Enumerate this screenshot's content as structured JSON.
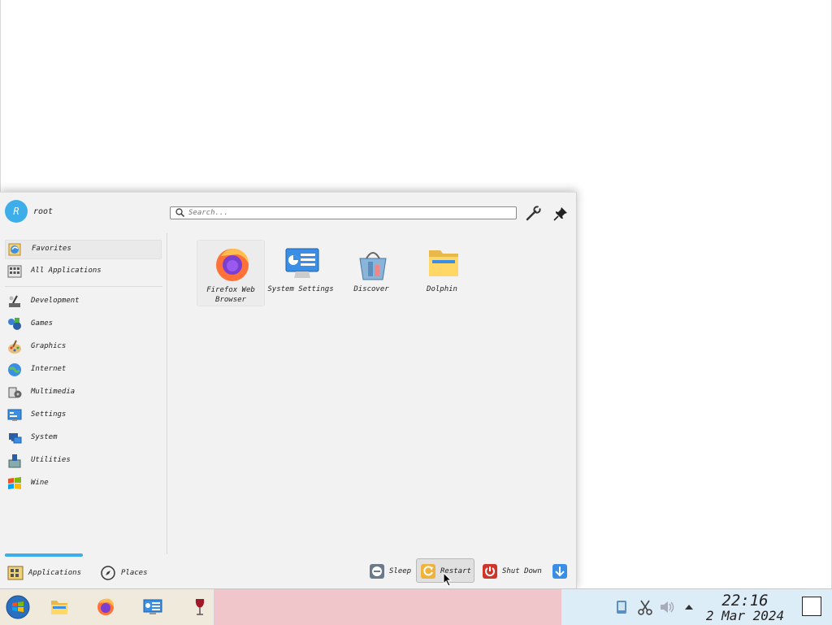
{
  "user": {
    "initial": "R",
    "name": "root"
  },
  "search": {
    "placeholder": "Search..."
  },
  "sidebar": {
    "items": [
      {
        "label": "Favorites",
        "icon": "favorites-icon",
        "active": true
      },
      {
        "label": "All Applications",
        "icon": "all-applications-icon"
      },
      {
        "label": "Development",
        "icon": "development-icon"
      },
      {
        "label": "Games",
        "icon": "games-icon"
      },
      {
        "label": "Graphics",
        "icon": "graphics-icon"
      },
      {
        "label": "Internet",
        "icon": "internet-icon"
      },
      {
        "label": "Multimedia",
        "icon": "multimedia-icon"
      },
      {
        "label": "Settings",
        "icon": "settings-icon"
      },
      {
        "label": "System",
        "icon": "system-icon"
      },
      {
        "label": "Utilities",
        "icon": "utilities-icon"
      },
      {
        "label": "Wine",
        "icon": "wine-icon"
      }
    ]
  },
  "favorites": [
    {
      "label": "Firefox Web Browser",
      "icon": "firefox-icon"
    },
    {
      "label": "System Settings",
      "icon": "system-settings-icon"
    },
    {
      "label": "Discover",
      "icon": "discover-icon"
    },
    {
      "label": "Dolphin",
      "icon": "dolphin-icon"
    }
  ],
  "footer": {
    "tabs": [
      {
        "label": "Applications",
        "icon": "applications-icon",
        "active": true
      },
      {
        "label": "Places",
        "icon": "places-icon"
      }
    ],
    "power": [
      {
        "label": "Sleep",
        "icon": "sleep-icon"
      },
      {
        "label": "Restart",
        "icon": "restart-icon"
      },
      {
        "label": "Shut Down",
        "icon": "shutdown-icon"
      }
    ]
  },
  "taskbar": {
    "apps": [
      "start-menu-icon",
      "file-manager-icon",
      "firefox-icon",
      "system-settings-icon",
      "wine-icon"
    ],
    "tray": [
      "kde-connect-icon",
      "scissors-icon",
      "volume-icon",
      "expand-tray-icon"
    ],
    "clock": {
      "time": "22:16",
      "date": "2 Mar 2024"
    }
  },
  "colors": {
    "accent": "#3daee9",
    "launcher_bg": "#f2f2f2",
    "taskbar_middle": "#f1c6cb",
    "taskbar_right": "#dcedf7"
  }
}
